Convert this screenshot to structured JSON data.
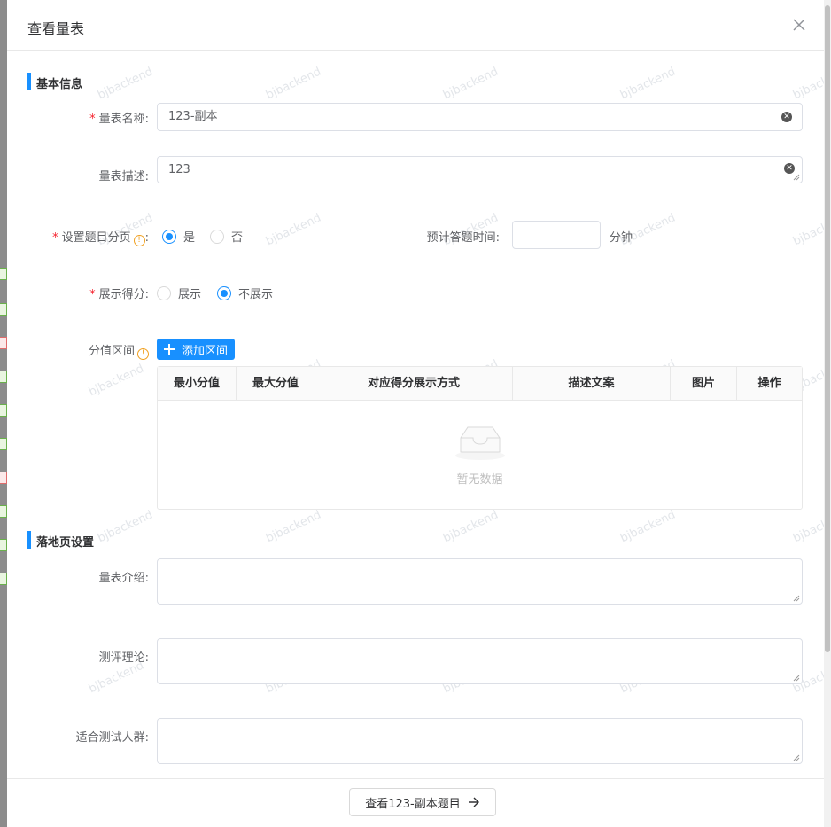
{
  "dialog": {
    "title": "查看量表"
  },
  "sections": {
    "basic": "基本信息",
    "landing": "落地页设置"
  },
  "form": {
    "name": {
      "label": "量表名称:",
      "value": "123-副本",
      "required": true
    },
    "desc": {
      "label": "量表描述:",
      "value": "123"
    },
    "paging": {
      "label": "设置题目分页",
      "colon": ":",
      "required": true,
      "options": [
        "是",
        "否"
      ],
      "selected": "是"
    },
    "time": {
      "label": "预计答题时间:",
      "value": "",
      "unit": "分钟"
    },
    "show_score": {
      "label": "展示得分:",
      "required": true,
      "options": [
        "展示",
        "不展示"
      ],
      "selected": "不展示"
    },
    "range": {
      "label": "分值区间",
      "add_button": "添加区间"
    },
    "intro": {
      "label": "量表介绍:"
    },
    "theory": {
      "label": "测评理论:"
    },
    "audience": {
      "label": "适合测试人群:"
    }
  },
  "table": {
    "columns": [
      "最小分值",
      "最大分值",
      "对应得分展示方式",
      "描述文案",
      "图片",
      "操作"
    ],
    "rows": [],
    "empty_text": "暂无数据"
  },
  "footer": {
    "button": "查看123-副本题目"
  },
  "watermark": "bjbackend",
  "colors": {
    "primary": "#1890ff",
    "required": "#f5222d",
    "info": "#f0a020"
  }
}
